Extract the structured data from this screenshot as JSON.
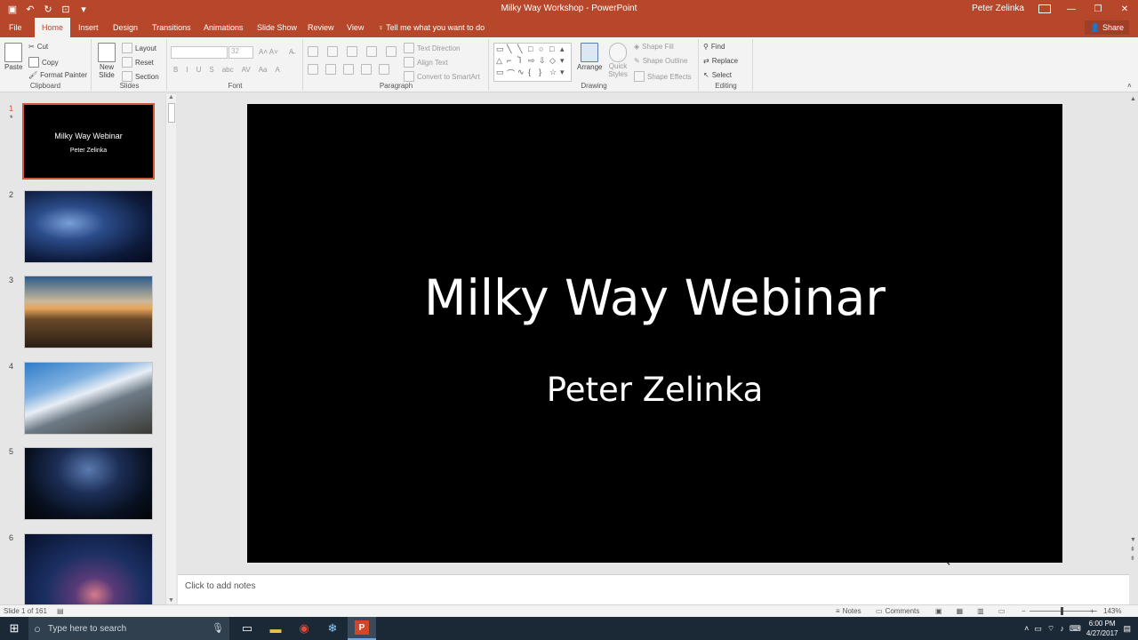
{
  "window": {
    "title": "Milky Way Workshop - PowerPoint",
    "user": "Peter Zelinka",
    "share_label": "Share"
  },
  "tabs": [
    "File",
    "Home",
    "Insert",
    "Design",
    "Transitions",
    "Animations",
    "Slide Show",
    "Review",
    "View"
  ],
  "active_tab": "Home",
  "tell_me": "Tell me what you want to do",
  "ribbon": {
    "clipboard": {
      "paste": "Paste",
      "cut": "Cut",
      "copy": "Copy",
      "format_painter": "Format Painter",
      "label": "Clipboard"
    },
    "slides": {
      "new_slide": "New Slide",
      "layout": "Layout",
      "reset": "Reset",
      "section": "Section",
      "label": "Slides"
    },
    "font": {
      "size": "32",
      "label": "Font"
    },
    "paragraph": {
      "text_direction": "Text Direction",
      "align_text": "Align Text",
      "convert_smartart": "Convert to SmartArt",
      "label": "Paragraph"
    },
    "drawing": {
      "arrange": "Arrange",
      "quick_styles": "Quick Styles",
      "shape_fill": "Shape Fill",
      "shape_outline": "Shape Outline",
      "shape_effects": "Shape Effects",
      "label": "Drawing"
    },
    "editing": {
      "find": "Find",
      "replace": "Replace",
      "select": "Select",
      "label": "Editing"
    }
  },
  "thumbnails": [
    {
      "num": "1",
      "star": "*",
      "title": "Milky Way Webinar",
      "subtitle": "Peter Zelinka"
    },
    {
      "num": "2",
      "star": ""
    },
    {
      "num": "3",
      "star": ""
    },
    {
      "num": "4",
      "star": ""
    },
    {
      "num": "5",
      "star": ""
    },
    {
      "num": "6",
      "star": ""
    }
  ],
  "slide": {
    "title": "Milky Way Webinar",
    "subtitle": "Peter Zelinka"
  },
  "notes_placeholder": "Click to add notes",
  "status": {
    "slide_of": "Slide 1 of 161",
    "notes": "Notes",
    "comments": "Comments",
    "zoom": "143%"
  },
  "taskbar": {
    "search_placeholder": "Type here to search",
    "time": "6:00 PM",
    "date": "4/27/2017"
  },
  "colors": {
    "accent": "#b7472a",
    "selected_thumb_border": "#d2583e"
  }
}
